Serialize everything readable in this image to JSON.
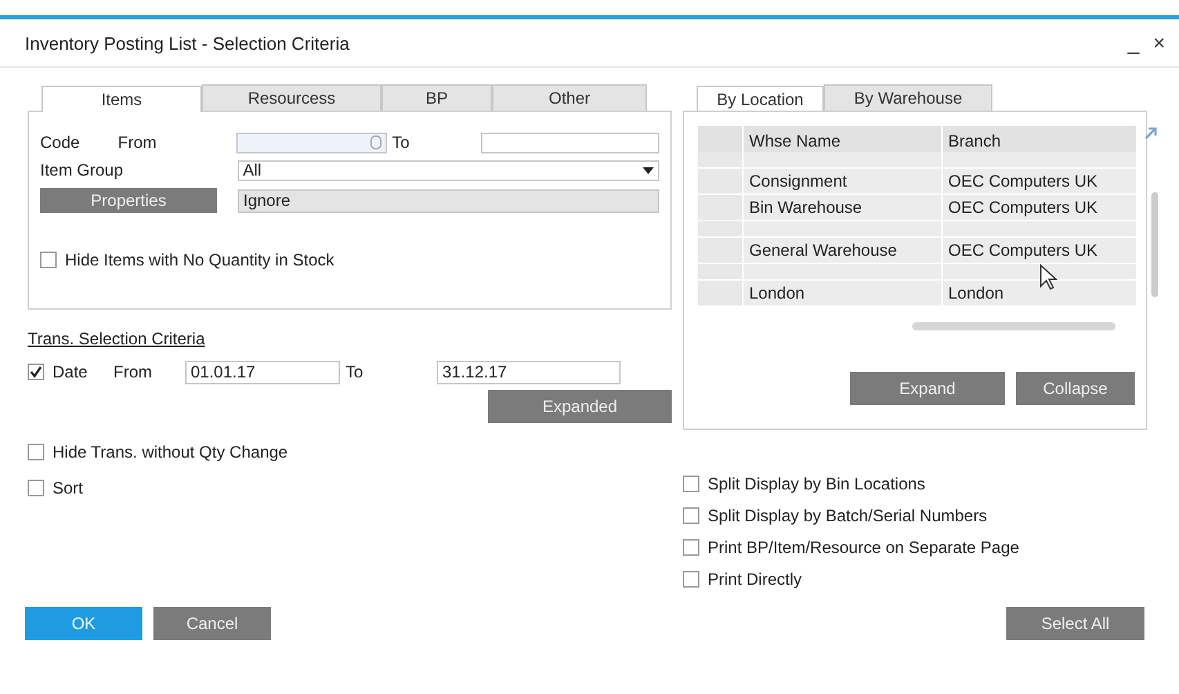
{
  "window": {
    "title": "Inventory Posting List - Selection Criteria",
    "controls": [
      "_",
      "×"
    ]
  },
  "left_tabs": [
    {
      "label": "Items",
      "selected": true
    },
    {
      "label": "Resourcess",
      "selected": false
    },
    {
      "label": "BP",
      "selected": false
    },
    {
      "label": "Other",
      "selected": false
    }
  ],
  "items_tab": {
    "code": {
      "label": "Code",
      "from_label": "From",
      "to_label": "To"
    },
    "item_group": {
      "label": "Item Group",
      "value": "All"
    },
    "properties": {
      "button": "Properties",
      "value": "Ignore"
    },
    "hide_no_stock": {
      "label": "Hide Items with No Quantity in Stock",
      "checked": false
    }
  },
  "trans_criteria": {
    "heading": "Trans. Selection Criteria",
    "date": {
      "label": "Date",
      "checked": true,
      "from_label": "From",
      "from_value": "01.01.17",
      "to_label": "To",
      "to_value": "31.12.17"
    },
    "expanded_button": "Expanded",
    "options": [
      {
        "label": "Hide Trans. without Qty Change",
        "checked": false
      },
      {
        "label": "Sort",
        "checked": false
      }
    ]
  },
  "right_tabs": [
    {
      "label": "By Location",
      "selected": true
    },
    {
      "label": "By Warehouse",
      "selected": false
    }
  ],
  "grid": {
    "columns": [
      "Whse Name",
      "Branch"
    ],
    "rows": [
      {
        "kind": "blank"
      },
      {
        "kind": "entry",
        "whse_name": "Consignment",
        "branch": "OEC Computers UK"
      },
      {
        "kind": "entry",
        "whse_name": "Bin Warehouse",
        "branch": "OEC Computers UK"
      },
      {
        "kind": "blank"
      },
      {
        "kind": "entry",
        "whse_name": "General Warehouse",
        "branch": "OEC Computers UK"
      },
      {
        "kind": "blank"
      },
      {
        "kind": "entry",
        "whse_name": "London",
        "branch": "London"
      }
    ]
  },
  "grid_buttons": [
    "Expand",
    "Collapse"
  ],
  "print_options": [
    {
      "label": "Split Display by Bin Locations",
      "checked": false
    },
    {
      "label": "Split Display by Batch/Serial Numbers",
      "checked": false
    },
    {
      "label": "Print BP/Item/Resource on Separate Page",
      "checked": false
    },
    {
      "label": "Print Directly",
      "checked": false
    }
  ],
  "footer": {
    "ok": "OK",
    "cancel": "Cancel",
    "select_all": "Select All"
  }
}
